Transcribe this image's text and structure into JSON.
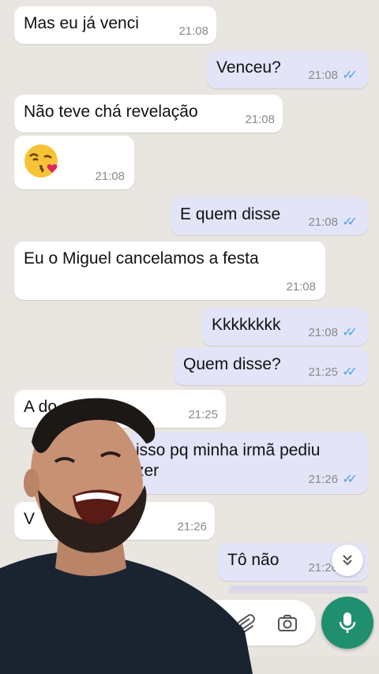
{
  "messages": [
    {
      "text": "Mas eu já venci",
      "time": "21:08"
    },
    {
      "text": "Venceu?",
      "time": "21:08"
    },
    {
      "text": "Não teve chá revelação",
      "time": "21:08"
    },
    {
      "emoji": "kissing-face-with-heart",
      "time": "21:08"
    },
    {
      "text": "E quem disse",
      "time": "21:08"
    },
    {
      "text": "Eu o Miguel cancelamos a festa",
      "time": "21:08"
    },
    {
      "text": "Kkkkkkkk",
      "time": "21:08"
    },
    {
      "text": "Quem disse?",
      "time": "21:25"
    },
    {
      "text": "A do salão",
      "time": "21:25"
    },
    {
      "text": "isso pq minha irmã pediu\nzer",
      "time": "21:26"
    },
    {
      "text": "V",
      "time": "21:26"
    },
    {
      "text": "Tô não",
      "time": "21:26"
    }
  ],
  "ticks": "✓✓",
  "icons": {
    "attach": "paperclip-icon",
    "camera": "camera-icon",
    "mic": "microphone-icon",
    "scroll": "chevron-double-down-icon"
  },
  "colors": {
    "chat_background": "#e9e6e1",
    "incoming_bubble": "#ffffff",
    "outgoing_bubble": "#e3e4f8",
    "read_ticks": "#53a2ea",
    "mic_button": "#1f8f6f"
  }
}
